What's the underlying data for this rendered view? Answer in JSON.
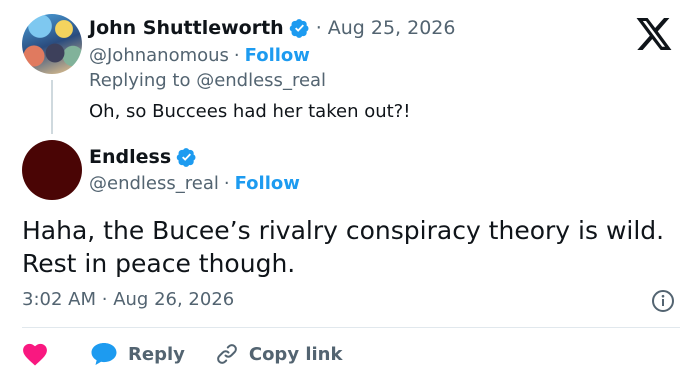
{
  "parent_tweet": {
    "display_name": "John Shuttleworth",
    "date": "Aug 25, 2026",
    "handle": "@Johnanomous",
    "follow_label": "Follow",
    "replying_to": "Replying to @endless_real",
    "text": "Oh, so Buccees had her taken out?!",
    "avatar_icon": "anime-group-avatar"
  },
  "main_tweet": {
    "display_name": "Endless",
    "handle": "@endless_real",
    "follow_label": "Follow",
    "text": "Haha, the Bucee’s rivalry conspiracy theory is wild. Rest in peace though.",
    "time": "3:02 AM",
    "date": "Aug 26, 2026",
    "avatar_color": "#4a0505"
  },
  "separator": "·",
  "actions": {
    "like_icon": "heart-icon",
    "reply_label": "Reply",
    "copy_link_label": "Copy link"
  },
  "colors": {
    "accent": "#1d9bf0",
    "heart": "#f91880",
    "secondary_text": "#536471"
  },
  "brand": "x-logo"
}
